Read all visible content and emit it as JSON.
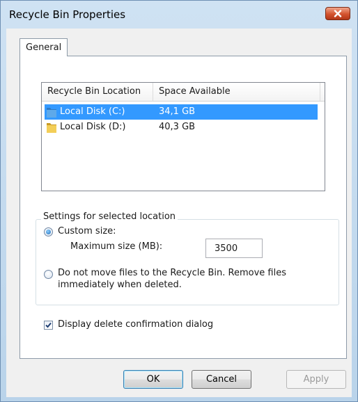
{
  "window": {
    "title": "Recycle Bin Properties",
    "close_icon": "close-x-icon"
  },
  "tabs": [
    {
      "label": "General",
      "selected": true
    }
  ],
  "locations": {
    "columns": [
      "Recycle Bin Location",
      "Space Available"
    ],
    "rows": [
      {
        "name": "Local Disk (C:)",
        "space": "34,1 GB",
        "selected": true,
        "icon": "drive-folder-icon"
      },
      {
        "name": "Local Disk (D:)",
        "space": "40,3 GB",
        "selected": false,
        "icon": "drive-folder-icon"
      }
    ]
  },
  "settings": {
    "group_label": "Settings for selected location",
    "custom_size_label": "Custom size:",
    "custom_size_selected": true,
    "max_size_label": "Maximum size (MB):",
    "max_size_value": "3500",
    "no_move_label_line1": "Do not move files to the Recycle Bin. Remove files",
    "no_move_label_line2": "immediately when deleted.",
    "no_move_selected": false
  },
  "confirm": {
    "label": "Display delete confirmation dialog",
    "checked": true
  },
  "buttons": {
    "ok": "OK",
    "cancel": "Cancel",
    "apply": "Apply"
  },
  "colors": {
    "selection": "#3399ff",
    "close_button": "#d3532e"
  }
}
